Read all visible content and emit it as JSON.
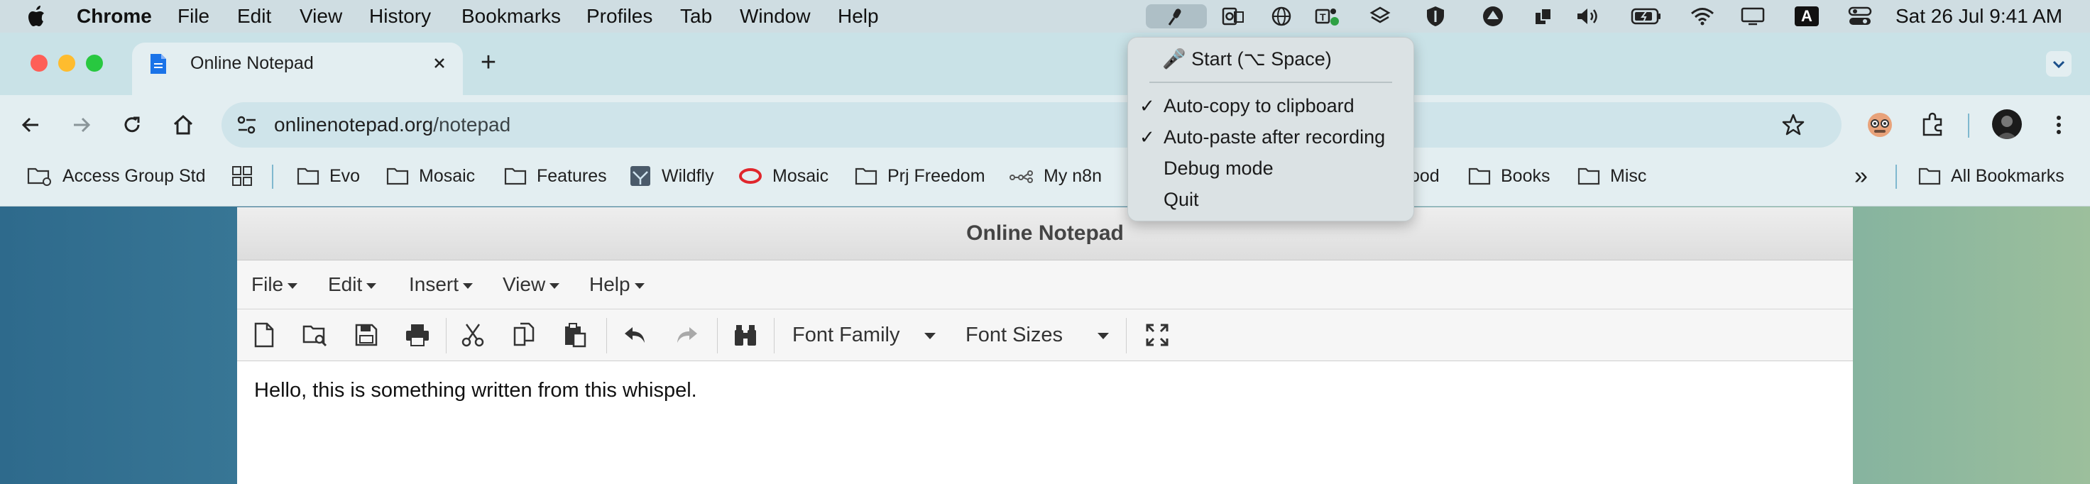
{
  "menubar": {
    "app": "Chrome",
    "items": [
      "File",
      "Edit",
      "View",
      "History",
      "Bookmarks",
      "Profiles",
      "Tab",
      "Window",
      "Help"
    ],
    "status_icons": [
      "microphone-icon",
      "outlook-icon",
      "globe-icon",
      "teams-icon",
      "layers-icon",
      "shield-icon",
      "vpn-icon",
      "clipboard-icon",
      "volume-icon",
      "battery-icon",
      "wifi-icon",
      "display-icon",
      "input-source-icon",
      "control-center-icon"
    ],
    "input_source_letter": "A",
    "clock": "Sat 26 Jul  9:41 AM"
  },
  "browser": {
    "tab_title": "Online Notepad",
    "new_tab_symbol": "+",
    "url_domain": "onlinenotepad.org",
    "url_path": "/notepad",
    "bookmarks": [
      {
        "label": "Access Group Std",
        "icon": "folder-gear-icon"
      },
      {
        "label": "Evo",
        "icon": "folder-icon"
      },
      {
        "label": "Mosaic",
        "icon": "folder-icon"
      },
      {
        "label": "Features",
        "icon": "folder-icon"
      },
      {
        "label": "Wildfly",
        "icon": "wildfly-icon"
      },
      {
        "label": "Mosaic",
        "icon": "oracle-icon"
      },
      {
        "label": "Prj Freedom",
        "icon": "folder-icon"
      },
      {
        "label": "My n8n",
        "icon": "n8n-icon"
      },
      {
        "label": "ood",
        "icon": "none"
      },
      {
        "label": "Books",
        "icon": "folder-icon"
      },
      {
        "label": "Misc",
        "icon": "folder-icon"
      }
    ],
    "overflow_symbol": "»",
    "all_bookmarks": "All Bookmarks"
  },
  "dropdown": {
    "start": "🎤 Start (⌥ Space)",
    "items": [
      {
        "label": "Auto-copy to clipboard",
        "checked": true
      },
      {
        "label": "Auto-paste after recording",
        "checked": true
      },
      {
        "label": "Debug mode",
        "checked": false
      },
      {
        "label": "Quit",
        "checked": false
      }
    ],
    "check_symbol": "✓"
  },
  "notepad": {
    "title": "Online Notepad",
    "menu": [
      "File",
      "Edit",
      "Insert",
      "View",
      "Help"
    ],
    "font_family": "Font Family",
    "font_sizes": "Font Sizes",
    "content": "Hello, this is something written from this whispel."
  },
  "colors": {
    "menubar_bg": "#cfdde2",
    "chrome_frame": "#c9e2e7",
    "chrome_toolbar": "#e3eef1",
    "tab_icon": "#1a73e8",
    "traffic_red": "#fe5f57",
    "traffic_yellow": "#febc2e",
    "traffic_green": "#28c840"
  }
}
